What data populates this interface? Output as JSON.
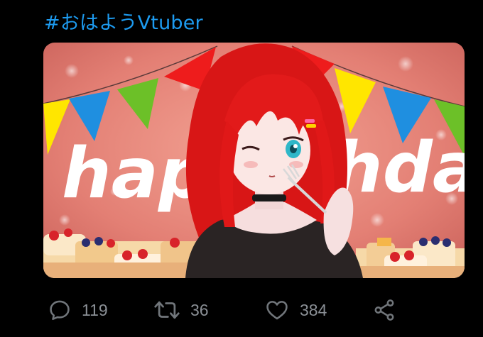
{
  "tweet": {
    "hashtag": "#おはようVtuber"
  },
  "media": {
    "banner_text_left": "happy",
    "banner_text_right": "hday",
    "colors": {
      "background": "#e8857a",
      "hair": "#e01818",
      "flag_red": "#ee1c1c",
      "flag_yellow": "#ffe600",
      "flag_blue": "#1f8fe0",
      "flag_green": "#6cc028"
    }
  },
  "actions": {
    "reply": {
      "icon": "reply-icon",
      "count": "119"
    },
    "retweet": {
      "icon": "retweet-icon",
      "count": "36"
    },
    "like": {
      "icon": "heart-icon",
      "count": "384"
    },
    "share": {
      "icon": "share-icon"
    }
  }
}
